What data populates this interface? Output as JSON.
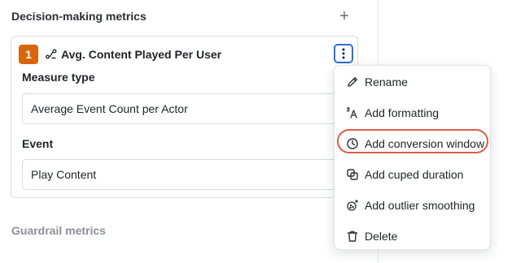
{
  "sections": {
    "decision_title": "Decision-making metrics",
    "guardrail_title": "Guardrail metrics",
    "add_symbol": "+"
  },
  "metric": {
    "index": "1",
    "name": "Avg. Content Played Per User",
    "type_icon": "metric-flow-icon",
    "measure_type_label": "Measure type",
    "measure_type_value": "Average Event Count per Actor",
    "event_label": "Event",
    "event_value": "Play Content",
    "accent": "#d9650e"
  },
  "menu": {
    "items": [
      {
        "label": "Rename",
        "icon": "pencil-icon"
      },
      {
        "label": "Add formatting",
        "icon": "formatting-icon"
      },
      {
        "label": "Add conversion window",
        "icon": "clock-icon",
        "highlighted": true
      },
      {
        "label": "Add cuped duration",
        "icon": "squares-icon"
      },
      {
        "label": "Add outlier smoothing",
        "icon": "sparkle-circle-icon"
      },
      {
        "label": "Delete",
        "icon": "trash-icon"
      }
    ]
  },
  "colors": {
    "focus_border": "#2f6fd3",
    "highlight_ring": "#e05a45"
  }
}
